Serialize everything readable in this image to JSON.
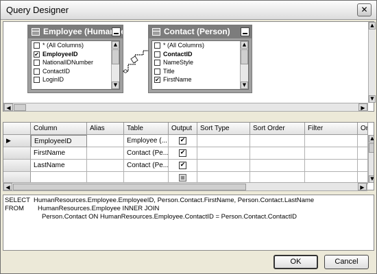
{
  "window": {
    "title": "Query Designer"
  },
  "tables": [
    {
      "name": "Employee (HumanResources)",
      "columns": [
        {
          "label": "* (All Columns)",
          "checked": false,
          "bold": false
        },
        {
          "label": "EmployeeID",
          "checked": true,
          "bold": true
        },
        {
          "label": "NationalIDNumber",
          "checked": false,
          "bold": false
        },
        {
          "label": "ContactID",
          "checked": false,
          "bold": false
        },
        {
          "label": "LoginID",
          "checked": false,
          "bold": false
        }
      ]
    },
    {
      "name": "Contact (Person)",
      "columns": [
        {
          "label": "* (All Columns)",
          "checked": false,
          "bold": false
        },
        {
          "label": "ContactID",
          "checked": false,
          "bold": true
        },
        {
          "label": "NameStyle",
          "checked": false,
          "bold": false
        },
        {
          "label": "Title",
          "checked": false,
          "bold": false
        },
        {
          "label": "FirstName",
          "checked": true,
          "bold": false
        }
      ]
    }
  ],
  "grid": {
    "headers": [
      "Column",
      "Alias",
      "Table",
      "Output",
      "Sort Type",
      "Sort Order",
      "Filter",
      "Or..."
    ],
    "rows": [
      {
        "column": "EmployeeID",
        "alias": "",
        "table": "Employee (...",
        "output": true,
        "selected": true
      },
      {
        "column": "FirstName",
        "alias": "",
        "table": "Contact (Pe...",
        "output": true,
        "selected": false
      },
      {
        "column": "LastName",
        "alias": "",
        "table": "Contact (Pe...",
        "output": true,
        "selected": false
      },
      {
        "column": "",
        "alias": "",
        "table": "",
        "output": null,
        "selected": false
      },
      {
        "column": "",
        "alias": "",
        "table": "",
        "output": null,
        "selected": false
      }
    ]
  },
  "sql": {
    "select_keyword": "SELECT",
    "select_text": "HumanResources.Employee.EmployeeID, Person.Contact.FirstName, Person.Contact.LastName",
    "from_keyword": "FROM",
    "from_text": "HumanResources.Employee INNER JOIN",
    "join_text": "Person.Contact ON HumanResources.Employee.ContactID = Person.Contact.ContactID"
  },
  "buttons": {
    "ok": "OK",
    "cancel": "Cancel"
  },
  "glyphs": {
    "close": "✕",
    "check": "✔",
    "up": "▲",
    "down": "▼",
    "left": "◀",
    "right": "▶",
    "row_pointer": "▶"
  }
}
